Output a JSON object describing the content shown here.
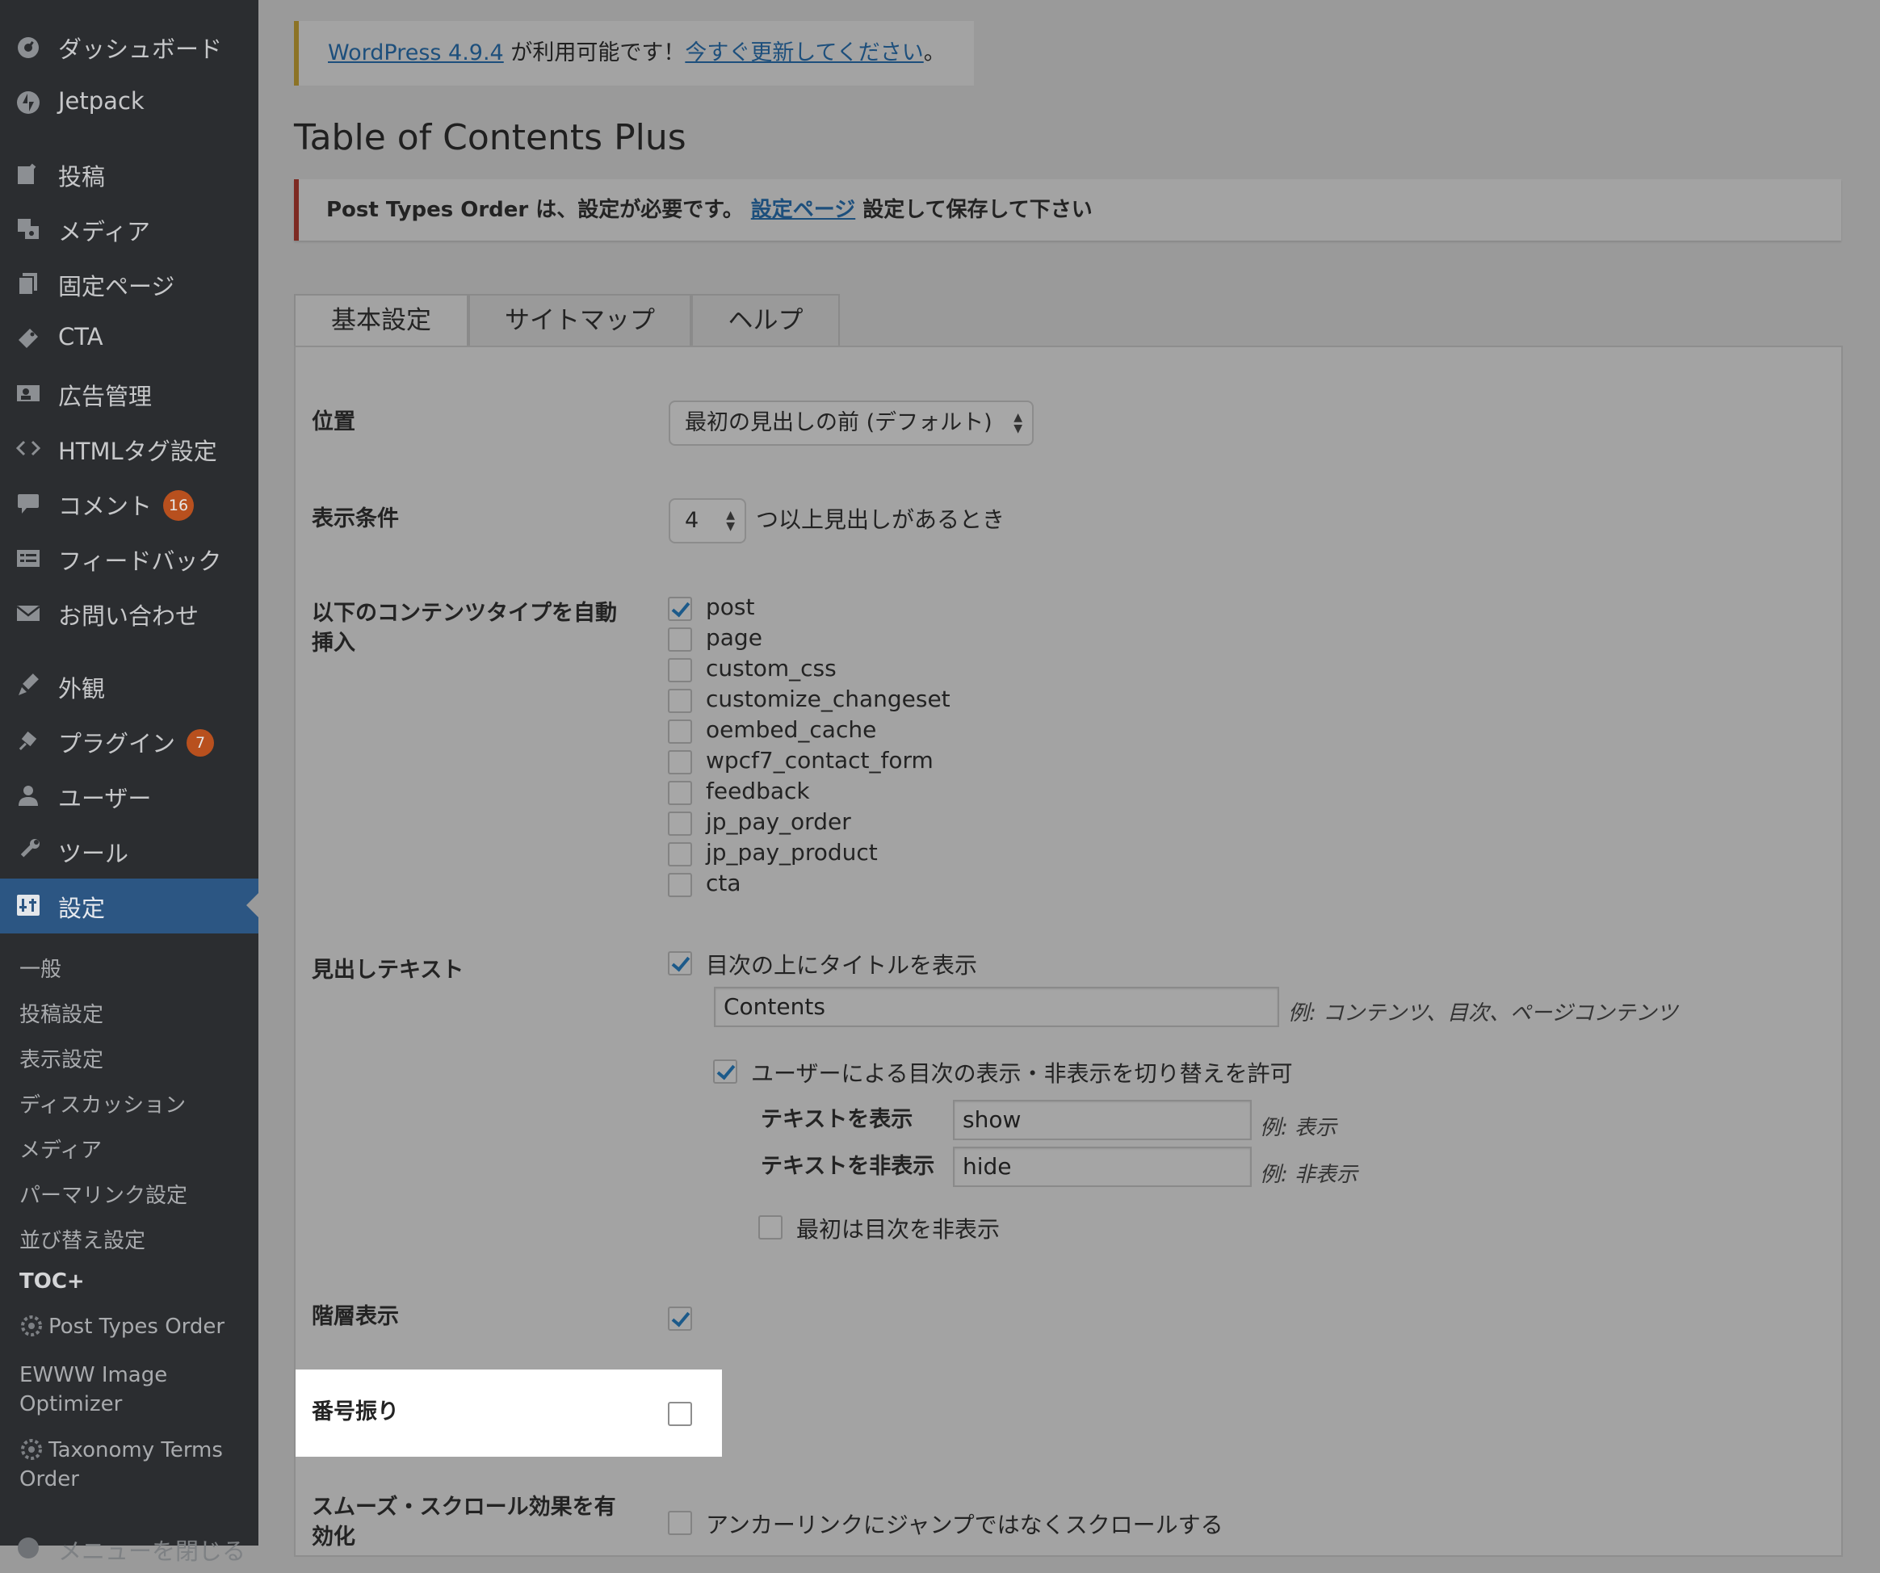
{
  "sidebar": {
    "menu": [
      {
        "label": "ダッシュボード",
        "icon": "dashboard-icon"
      },
      {
        "label": "Jetpack",
        "icon": "jetpack-icon"
      },
      {
        "label": "投稿",
        "icon": "posts-icon"
      },
      {
        "label": "メディア",
        "icon": "media-icon"
      },
      {
        "label": "固定ページ",
        "icon": "pages-icon"
      },
      {
        "label": "CTA",
        "icon": "cta-icon"
      },
      {
        "label": "広告管理",
        "icon": "ads-icon"
      },
      {
        "label": "HTMLタグ設定",
        "icon": "code-icon"
      },
      {
        "label": "コメント",
        "icon": "comments-icon",
        "badge": "16"
      },
      {
        "label": "フィードバック",
        "icon": "feedback-icon"
      },
      {
        "label": "お問い合わせ",
        "icon": "mail-icon"
      },
      {
        "label": "外観",
        "icon": "appearance-icon"
      },
      {
        "label": "プラグイン",
        "icon": "plugins-icon",
        "badge": "7"
      },
      {
        "label": "ユーザー",
        "icon": "users-icon"
      },
      {
        "label": "ツール",
        "icon": "tools-icon"
      },
      {
        "label": "設定",
        "icon": "settings-icon",
        "active": true
      }
    ],
    "submenu": [
      "一般",
      "投稿設定",
      "表示設定",
      "ディスカッション",
      "メディア",
      "パーマリンク設定",
      "並び替え設定",
      "TOC+",
      "Post Types Order",
      "EWWW Image Optimizer",
      "Taxonomy Terms Order"
    ],
    "collapse_label": "メニューを閉じる"
  },
  "update_notice": {
    "link1": "WordPress 4.9.4",
    "text": " が利用可能です！",
    "link2": "今すぐ更新してください",
    "end": "。"
  },
  "page_title": "Table of Contents Plus",
  "error_notice": {
    "prefix": "Post Types Order は、設定が必要です。 ",
    "link": "設定ページ",
    "suffix": " 設定して保存して下さい"
  },
  "tabs": [
    "基本設定",
    "サイトマップ",
    "ヘルプ"
  ],
  "settings": {
    "position_label": "位置",
    "position_value": "最初の見出しの前 (デフォルト)",
    "condition_label": "表示条件",
    "condition_value": "4",
    "condition_suffix": "つ以上見出しがあるとき",
    "autoinsert_label_1": "以下のコンテンツタイプを自動",
    "autoinsert_label_2": "挿入",
    "post_types": [
      {
        "name": "post",
        "checked": true
      },
      {
        "name": "page",
        "checked": false
      },
      {
        "name": "custom_css",
        "checked": false
      },
      {
        "name": "customize_changeset",
        "checked": false
      },
      {
        "name": "oembed_cache",
        "checked": false
      },
      {
        "name": "wpcf7_contact_form",
        "checked": false
      },
      {
        "name": "feedback",
        "checked": false
      },
      {
        "name": "jp_pay_order",
        "checked": false
      },
      {
        "name": "jp_pay_product",
        "checked": false
      },
      {
        "name": "cta",
        "checked": false
      }
    ],
    "heading_label": "見出しテキスト",
    "show_title_label": "目次の上にタイトルを表示",
    "title_value": "Contents",
    "title_hint": "例: コンテンツ、目次、ページコンテンツ",
    "toggle_label": "ユーザーによる目次の表示・非表示を切り替えを許可",
    "show_text_label": "テキストを表示",
    "show_text_value": "show",
    "show_text_hint": "例: 表示",
    "hide_text_label": "テキストを非表示",
    "hide_text_value": "hide",
    "hide_text_hint": "例: 非表示",
    "hide_initially_label": "最初は目次を非表示",
    "hierarchy_label": "階層表示",
    "numbering_label": "番号振り",
    "smooth_label_1": "スムーズ・スクロール効果を有",
    "smooth_label_2": "効化",
    "smooth_option": "アンカーリンクにジャンプではなくスクロールする"
  }
}
